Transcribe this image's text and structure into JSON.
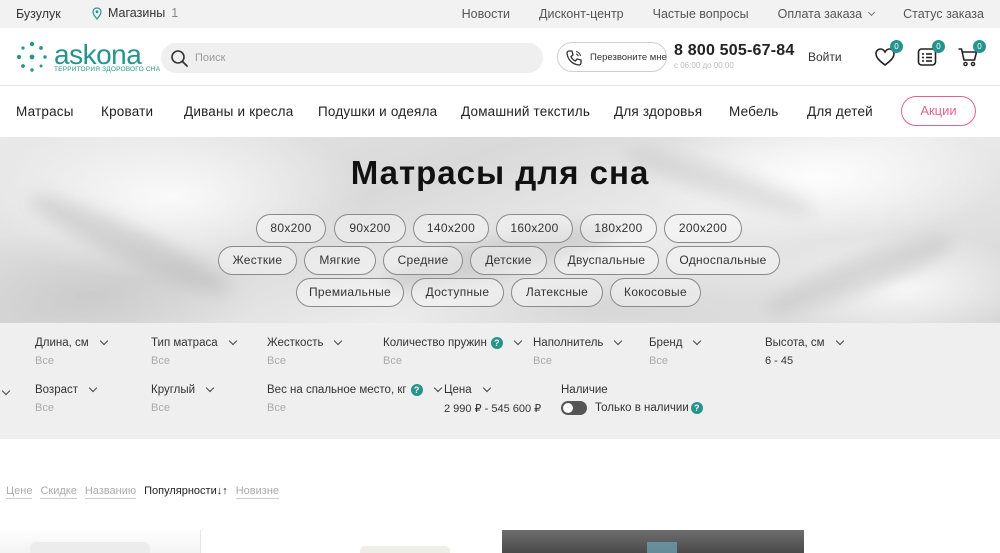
{
  "topbar": {
    "city": "Бузулук",
    "stores_label": "Магазины",
    "stores_count": "1",
    "links": [
      "Новости",
      "Дисконт-центр",
      "Частые вопросы",
      "Оплата заказа",
      "Статус заказа"
    ]
  },
  "header": {
    "logo_wordmark": "askona",
    "logo_tagline": "ТЕРРИТОРИЯ ЗДОРОВОГО СНА",
    "search_placeholder": "Поиск",
    "callback_label": "Перезвоните мне",
    "phone": "8 800 505-67-84",
    "hours": "с 06:00 до 00:00",
    "login_label": "Войти",
    "favorites_count": "0",
    "compare_count": "0",
    "cart_count": "0",
    "accent_color": "#26948c"
  },
  "nav": {
    "items": [
      "Матрасы",
      "Кровати",
      "Диваны и кресла",
      "Подушки и одеяла",
      "Домашний текстиль",
      "Для здоровья",
      "Мебель",
      "Для детей"
    ],
    "promo_label": "Акции",
    "promo_color": "#e4638a"
  },
  "hero": {
    "title": "Матрасы для сна",
    "size_chips": [
      "80x200",
      "90x200",
      "140x200",
      "160x200",
      "180x200",
      "200x200"
    ],
    "type_chips": [
      "Жесткие",
      "Мягкие",
      "Средние",
      "Детские",
      "Двуспальные",
      "Односпальные"
    ],
    "other_chips": [
      "Премиальные",
      "Доступные",
      "Латексные",
      "Кокосовые"
    ]
  },
  "filters": {
    "row1": [
      {
        "label": "Длина, см",
        "value": "Все"
      },
      {
        "label": "Тип матраса",
        "value": "Все"
      },
      {
        "label": "Жесткость",
        "value": "Все"
      },
      {
        "label": "Количество пружин",
        "value": "Все"
      },
      {
        "label": "Наполнитель",
        "value": "Все"
      },
      {
        "label": "Бренд",
        "value": "Все"
      },
      {
        "label": "Высота, см",
        "value": "6 - 45"
      }
    ],
    "row2": [
      {
        "label": "Возраст",
        "value": "Все"
      },
      {
        "label": "Круглый",
        "value": "Все"
      },
      {
        "label": "Вес на спальное место, кг",
        "value": "Все"
      },
      {
        "label": "Цена",
        "value": "2 990 ₽ - 545 600 ₽"
      }
    ],
    "stock": {
      "label": "Наличие",
      "toggle_label": "Только в наличии"
    }
  },
  "sort": {
    "options": [
      "Цене",
      "Скидке",
      "Названию",
      "Популярности↓↑",
      "Новизне"
    ],
    "active_index": 3
  }
}
